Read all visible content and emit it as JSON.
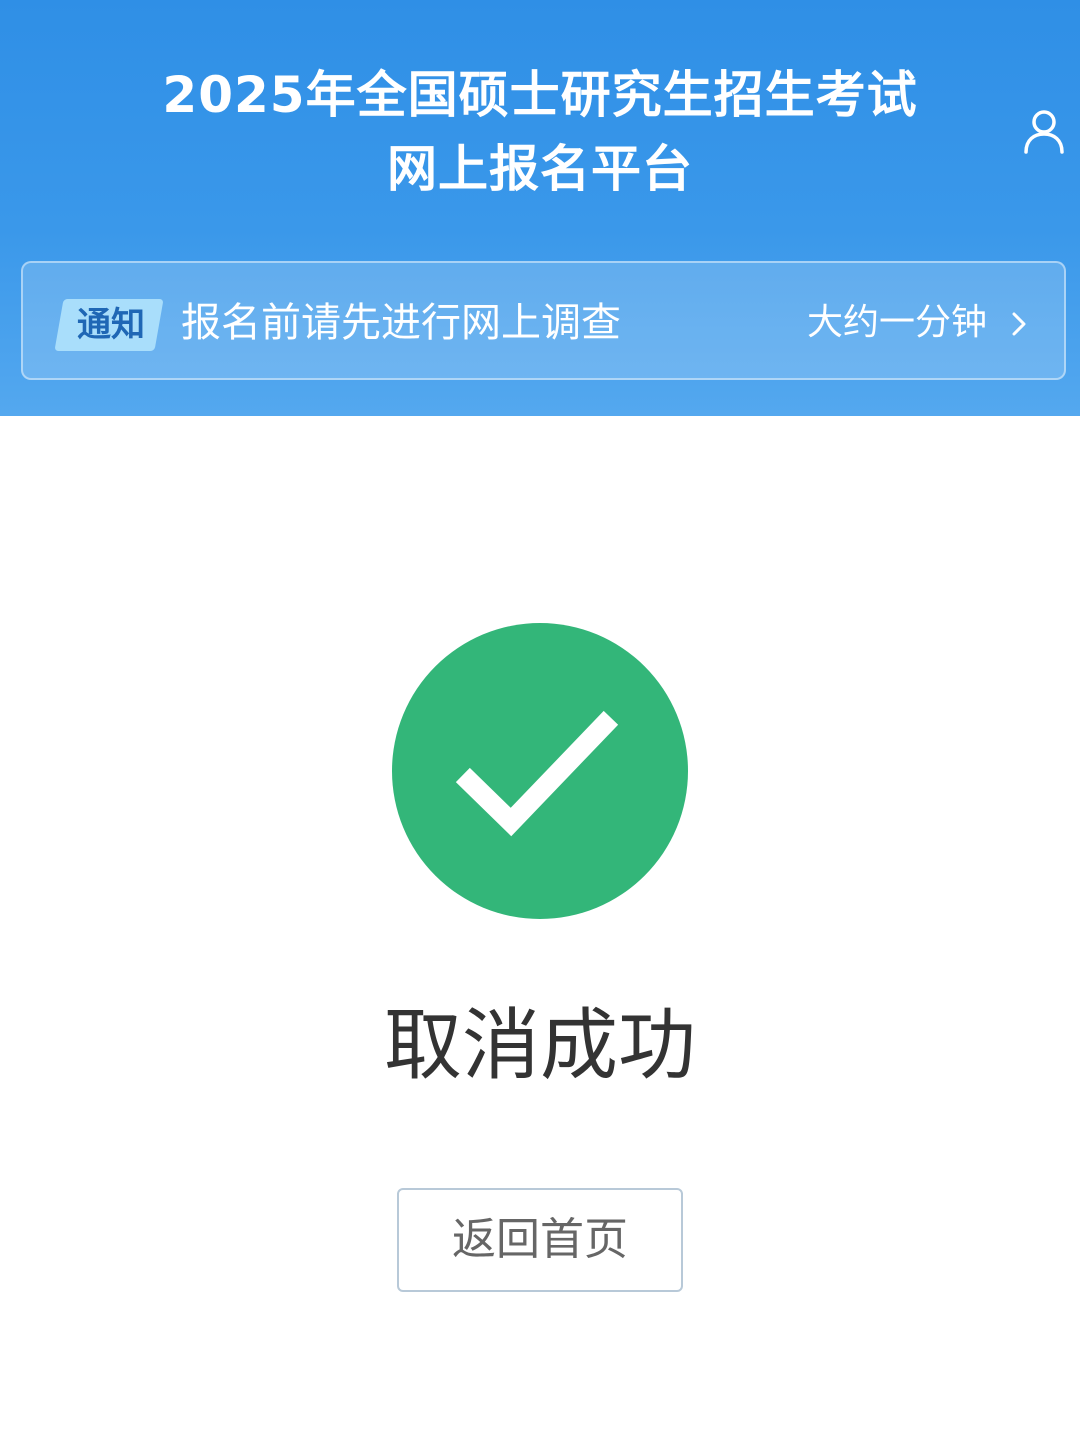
{
  "header": {
    "title_line1": "2025年全国硕士研究生招生考试",
    "title_line2": "网上报名平台",
    "user_icon": "user-icon",
    "background_color": "#2f8fe6"
  },
  "notice": {
    "badge": "通知",
    "text": "报名前请先进行网上调查",
    "link_label": "大约一分钟",
    "chevron_icon": "chevron-right-icon"
  },
  "result": {
    "icon": "success-check-icon",
    "icon_color": "#33b679",
    "status": "取消成功",
    "button_label": "返回首页"
  }
}
